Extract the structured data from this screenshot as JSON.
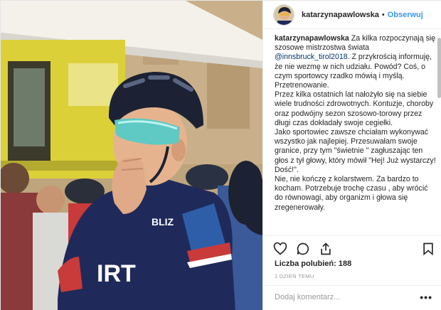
{
  "header": {
    "username": "katarzynapawlowska",
    "separator": "•",
    "follow_label": "Obserwuj"
  },
  "caption": {
    "username": "katarzynapawlowska",
    "intro": "Za kilka rozpoczynają się szosowe mistrzostwa świata",
    "mention": "@innsbruck_tirol2018",
    "p1": ". Z przykrością informuję, że nie wezmę w nich udziału. Powód? Coś, o czym sportowcy rzadko mówią i myślą. Przetrenowanie.",
    "p2": "Przez kilka ostatnich lat nałożyło się na siebie wiele trudności zdrowotnych. Kontuzje, choroby oraz podwójny sezon szosowo-torowy przez długi czas dokładały swoje cegiełki.",
    "p3": "Jako sportowiec zawsze chciałam wykonywać wszystko jak najlepiej. Przesuwałam swoje granice, przy tym \"świetnie \" zagłuszając ten głos z tył głowy, który mówił \"Hej! Już wystarczy! Dość!\".",
    "p4": "Nie, nie kończę z kolarstwem. Za bardzo to kocham. Potrzebuje trochę czasu , aby wrócić do równowagi, aby organizm i głowa się zregenerowały."
  },
  "likes": {
    "label": "Liczba polubień:",
    "count": "188"
  },
  "time": "1 DZIEŃ TEMU",
  "comment": {
    "placeholder": "Dodaj komentarz..."
  },
  "more_label": "•••",
  "photo": {
    "jersey_text": "IRT",
    "sponsor_text": "BLIZ",
    "colors": {
      "helmet": "#1c2233",
      "visor": "#5fc9c4",
      "jersey": "#1f2a5a",
      "truck": "#e4d93a",
      "skin": "#e5b48f"
    }
  },
  "icons": [
    "heart-icon",
    "comment-icon",
    "share-icon",
    "bookmark-icon"
  ]
}
